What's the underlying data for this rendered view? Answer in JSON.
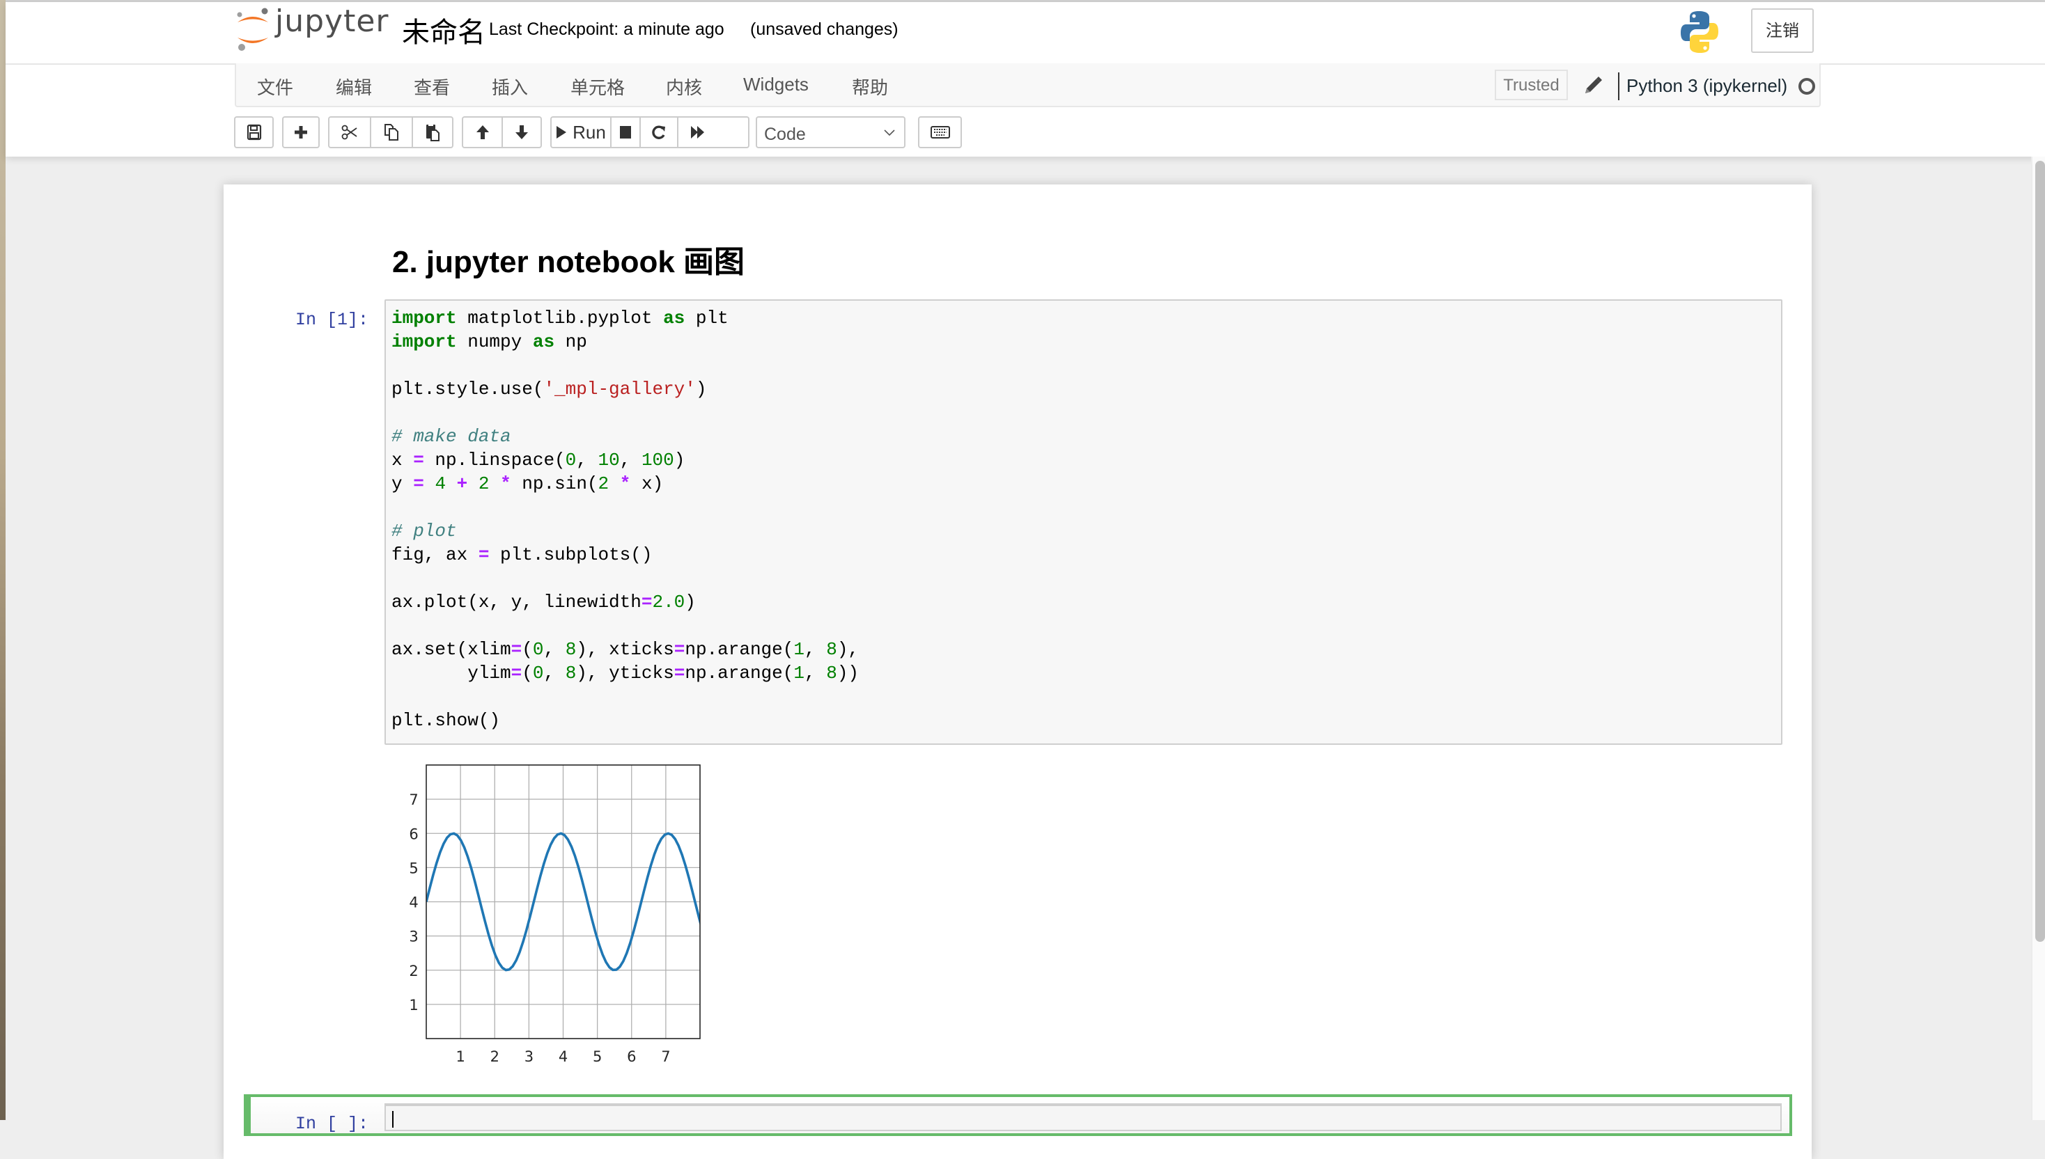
{
  "header": {
    "logo_text": "jupyter",
    "notebook_name": "未命名",
    "checkpoint": "Last Checkpoint: a minute ago",
    "autosave_status": "(unsaved changes)",
    "logout_label": "注销"
  },
  "menu": {
    "items": [
      {
        "label": "文件"
      },
      {
        "label": "编辑"
      },
      {
        "label": "查看"
      },
      {
        "label": "插入"
      },
      {
        "label": "单元格"
      },
      {
        "label": "内核"
      },
      {
        "label": "Widgets"
      },
      {
        "label": "帮助"
      }
    ],
    "trusted_label": "Trusted",
    "kernel_name": "Python 3 (ipykernel)"
  },
  "toolbar": {
    "run_label": "Run",
    "cell_type": "Code",
    "icons": [
      "save-icon",
      "plus-icon",
      "cut-icon",
      "copy-icon",
      "paste-icon",
      "arrow-up-icon",
      "arrow-down-icon",
      "play-icon",
      "stop-icon",
      "restart-icon",
      "fast-forward-icon",
      "keyboard-icon"
    ]
  },
  "notebook": {
    "heading": "2. jupyter notebook 画图",
    "cell1": {
      "prompt": "In [1]:",
      "code_lines": [
        "import matplotlib.pyplot as plt",
        "import numpy as np",
        "",
        "plt.style.use('_mpl-gallery')",
        "",
        "# make data",
        "x = np.linspace(0, 10, 100)",
        "y = 4 + 2 * np.sin(2 * x)",
        "",
        "# plot",
        "fig, ax = plt.subplots()",
        "",
        "ax.plot(x, y, linewidth=2.0)",
        "",
        "ax.set(xlim=(0, 8), xticks=np.arange(1, 8),",
        "       ylim=(0, 8), yticks=np.arange(1, 8))",
        "",
        "plt.show()"
      ]
    },
    "cell2": {
      "prompt": "In [ ]:",
      "code": ""
    }
  },
  "chart_data": {
    "type": "line",
    "title": "",
    "xlabel": "",
    "ylabel": "",
    "xlim": [
      0,
      8
    ],
    "ylim": [
      0,
      8
    ],
    "xticks": [
      1,
      2,
      3,
      4,
      5,
      6,
      7
    ],
    "yticks": [
      1,
      2,
      3,
      4,
      5,
      6,
      7
    ],
    "grid": true,
    "series": [
      {
        "name": "y = 4 + 2*sin(2x)",
        "color": "#1f77b4",
        "function": "4 + 2*sin(2*x)",
        "x_range": [
          0,
          10
        ],
        "n_points": 100
      }
    ]
  },
  "colors": {
    "accent_orange": "#f37626",
    "selected_cell_border": "#66bb6a",
    "prompt_blue": "#303f9f",
    "line_blue": "#1f77b4"
  }
}
